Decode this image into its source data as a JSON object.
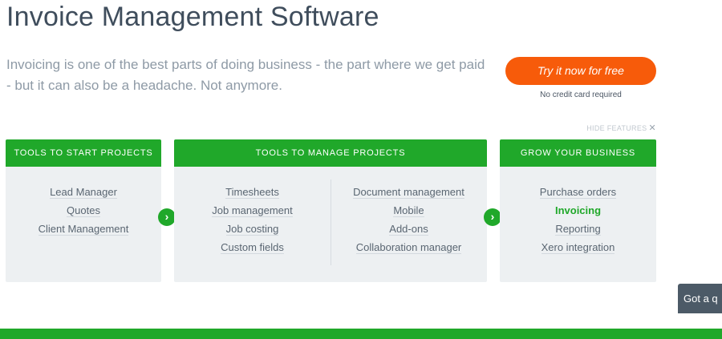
{
  "header": {
    "title": "Invoice Management Software",
    "lead": "Invoicing is one of the best parts of doing business - the part where we get paid - but it can also be a headache. Not anymore."
  },
  "cta": {
    "label": "Try it now for free",
    "note": "No credit card required"
  },
  "features": {
    "hide_label": "HIDE FEATURES",
    "start": {
      "heading": "TOOLS TO START PROJECTS",
      "items": [
        "Lead Manager",
        "Quotes",
        "Client Management"
      ]
    },
    "manage": {
      "heading": "TOOLS TO MANAGE PROJECTS",
      "left_items": [
        "Timesheets",
        "Job management",
        "Job costing",
        "Custom fields"
      ],
      "right_items": [
        "Document management",
        "Mobile",
        "Add-ons",
        "Collaboration manager"
      ]
    },
    "grow": {
      "heading": "GROW YOUR BUSINESS",
      "items": [
        "Purchase orders",
        "Invoicing",
        "Reporting",
        "Xero integration"
      ],
      "active_item": "Invoicing"
    }
  },
  "chat": {
    "label": "Got a q"
  },
  "colors": {
    "brand_green": "#20a82a",
    "cta_orange": "#f75b0a"
  },
  "icons": {
    "arrow": "chevron-right-icon",
    "close": "close-icon"
  }
}
